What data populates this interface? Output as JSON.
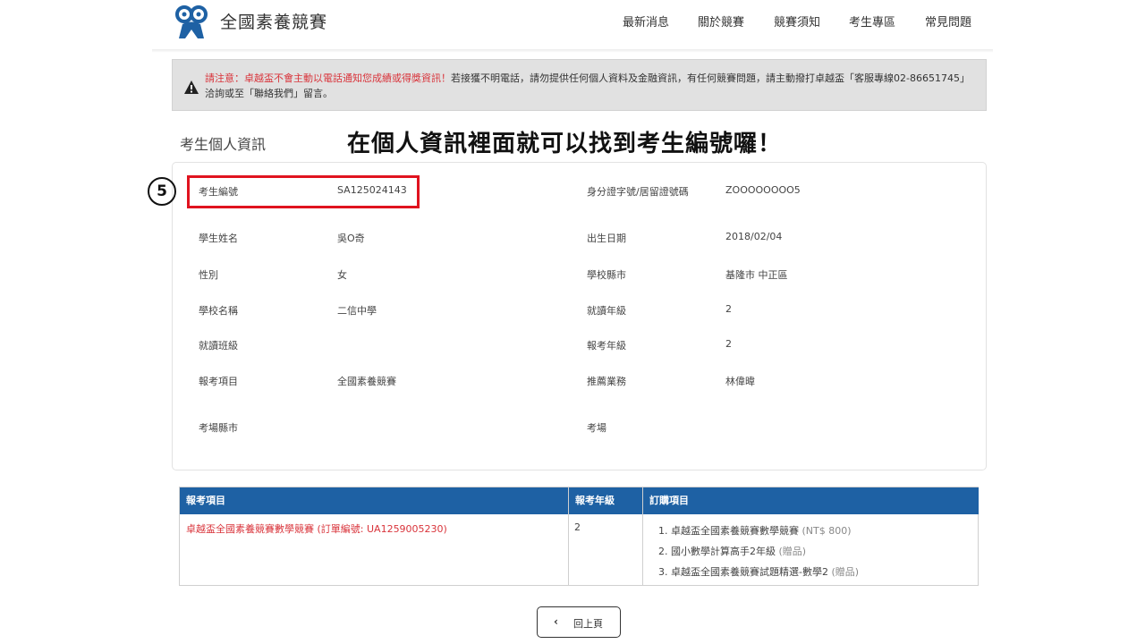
{
  "header": {
    "brand": "全國素養競賽",
    "nav": [
      "最新消息",
      "關於競賽",
      "競賽須知",
      "考生專區",
      "常見問題"
    ]
  },
  "notice": {
    "red_text": "請注意：卓越盃不會主動以電話通知您成績或得獎資訊！",
    "body_text": "若接獲不明電話，請勿提供任何個人資料及金融資訊，有任何競賽問題，請主動撥打卓越盃「客服專線02-86651745」洽詢或至「聯絡我們」留言。"
  },
  "section_title": "考生個人資訊",
  "annotation": {
    "text": "在個人資訊裡面就可以找到考生編號囉！",
    "step": "5"
  },
  "info": {
    "exam_no_label": "考生編號",
    "exam_no": "SA125024143",
    "id_label": "身分證字號/居留證號碼",
    "id": "ZOOOOOOOO5",
    "name_label": "學生姓名",
    "name": "吳O奇",
    "birth_label": "出生日期",
    "birth": "2018/02/04",
    "gender_label": "性別",
    "gender": "女",
    "school_city_label": "學校縣市",
    "school_city": "基隆市 中正區",
    "school_label": "學校名稱",
    "school": "二信中學",
    "grade_label": "就讀年級",
    "grade": "2",
    "class_label": "就讀班級",
    "class": "",
    "exam_grade_label": "報考年級",
    "exam_grade": "2",
    "exam_item_label": "報考項目",
    "exam_item": "全國素養競賽",
    "agent_label": "推薦業務",
    "agent": "林偉暐",
    "venue_city_label": "考場縣市",
    "venue_city": "",
    "venue_label": "考場",
    "venue": ""
  },
  "table": {
    "headers": [
      "報考項目",
      "報考年級",
      "訂購項目"
    ],
    "row": {
      "item": "卓越盃全國素養競賽數學競賽 (訂單編號: UA1259005230)",
      "grade": "2",
      "orders": [
        {
          "text": "1. 卓越盃全國素養競賽數學競賽",
          "note": "(NT$ 800)"
        },
        {
          "text": "2. 國小數學計算高手2年級",
          "note": "(贈品)"
        },
        {
          "text": "3. 卓越盃全國素養競賽試題精選-數學2",
          "note": "(贈品)"
        }
      ]
    }
  },
  "back_button": "回上頁",
  "colors": {
    "accent_blue": "#1e61a4",
    "warning_red": "#d9343b",
    "highlight_red": "#e0131f"
  }
}
